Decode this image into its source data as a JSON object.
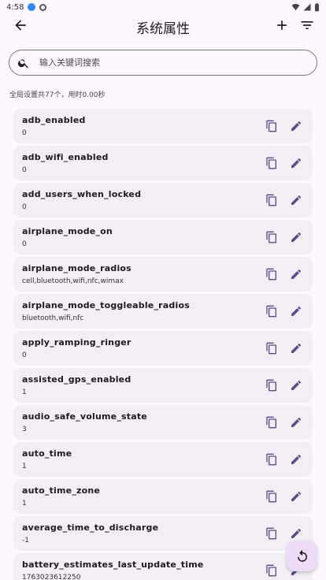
{
  "status": {
    "time": "4:58"
  },
  "header": {
    "title": "系统属性"
  },
  "search": {
    "placeholder": "输入关键词搜索"
  },
  "summary": "全局设置共77个，用时0.00秒",
  "items": [
    {
      "name": "adb_enabled",
      "value": "0"
    },
    {
      "name": "adb_wifi_enabled",
      "value": "0"
    },
    {
      "name": "add_users_when_locked",
      "value": "0"
    },
    {
      "name": "airplane_mode_on",
      "value": "0"
    },
    {
      "name": "airplane_mode_radios",
      "value": "cell,bluetooth,wifi,nfc,wimax"
    },
    {
      "name": "airplane_mode_toggleable_radios",
      "value": "bluetooth,wifi,nfc"
    },
    {
      "name": "apply_ramping_ringer",
      "value": "0"
    },
    {
      "name": "assisted_gps_enabled",
      "value": "1"
    },
    {
      "name": "audio_safe_volume_state",
      "value": "3"
    },
    {
      "name": "auto_time",
      "value": "1"
    },
    {
      "name": "auto_time_zone",
      "value": "1"
    },
    {
      "name": "average_time_to_discharge",
      "value": "-1"
    },
    {
      "name": "battery_estimates_last_update_time",
      "value": "1763023612250"
    }
  ],
  "colors": {
    "accent": "#5b4b8a",
    "card": "#f3edf5",
    "fab": "#ecdcf7"
  },
  "icons": {
    "back": "arrow-back-icon",
    "add": "plus-icon",
    "filter": "filter-icon",
    "search": "search-icon",
    "copy": "copy-icon",
    "edit": "pencil-icon",
    "fab": "refresh-icon"
  }
}
